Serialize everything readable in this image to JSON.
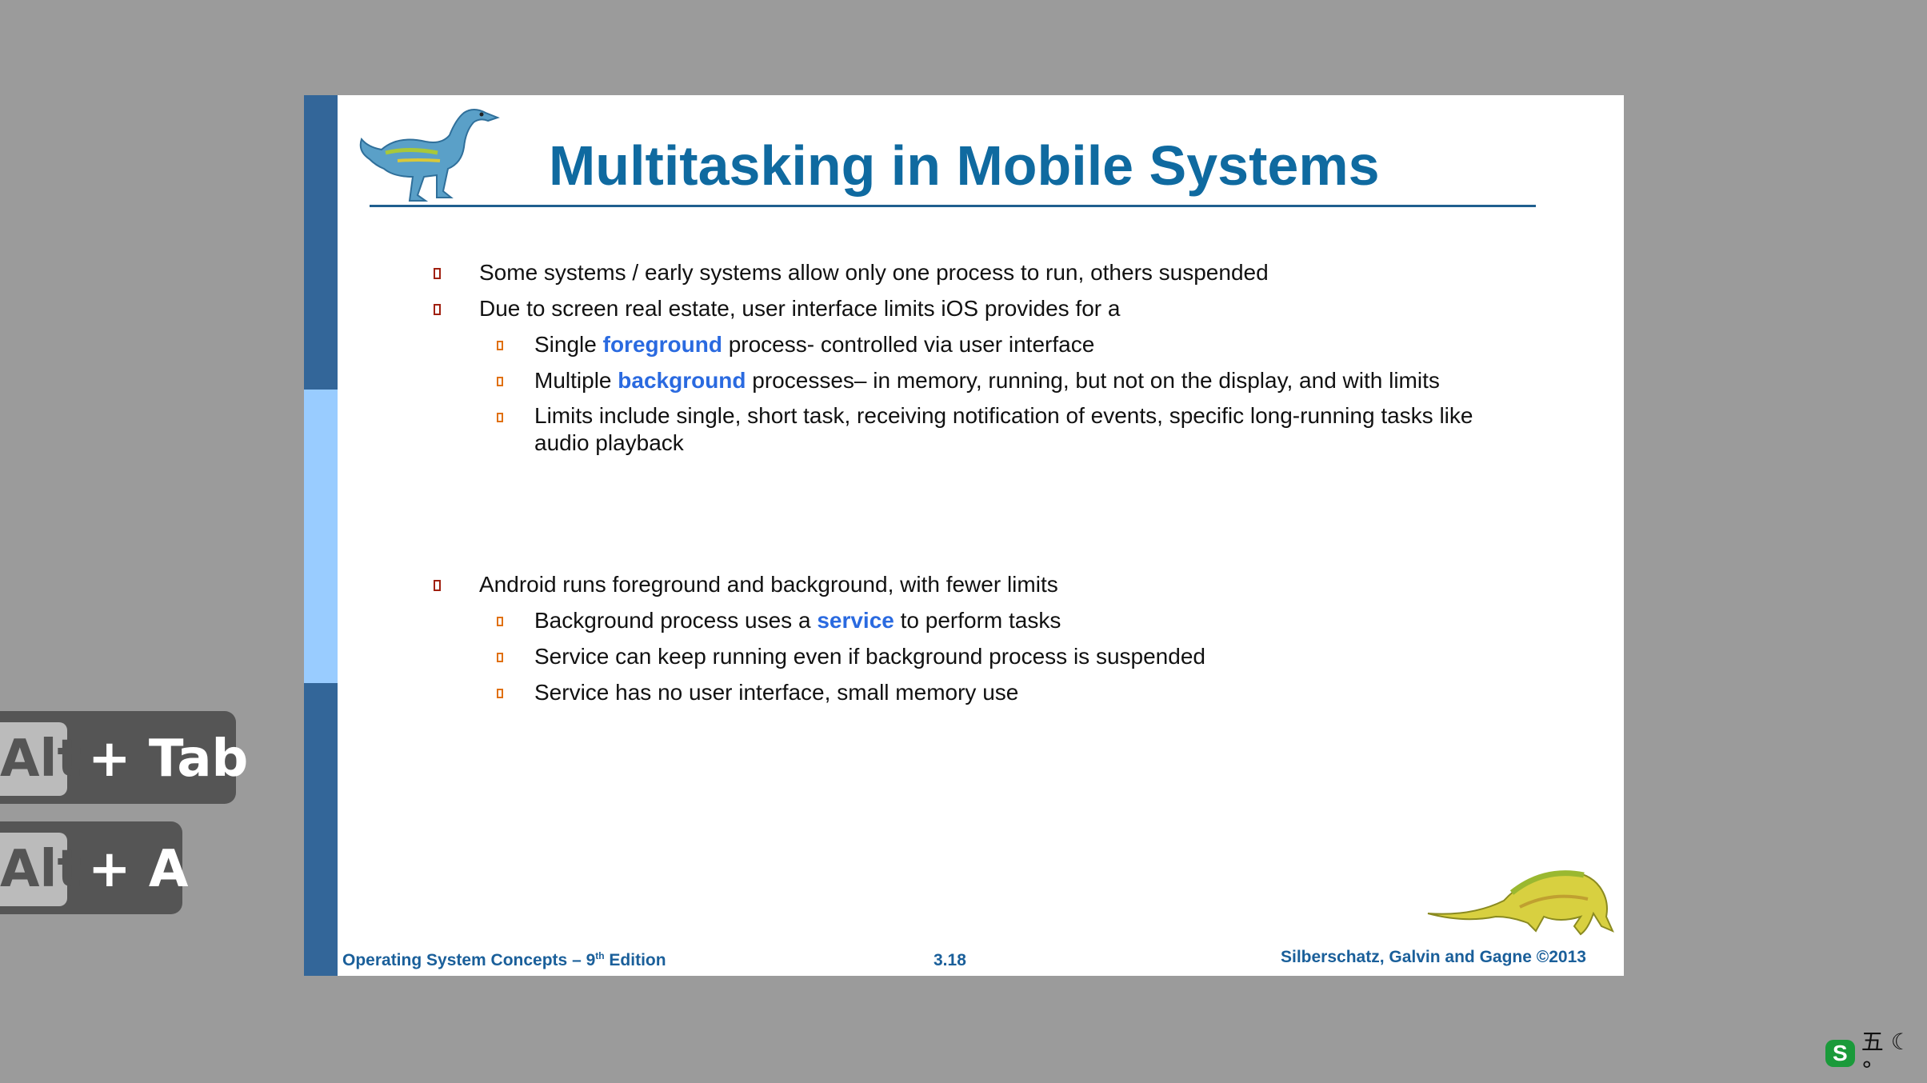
{
  "slide": {
    "title": "Multitasking in Mobile Systems",
    "bullets": [
      {
        "level": 1,
        "text": "Some systems / early systems allow only one process to run, others suspended"
      },
      {
        "level": 1,
        "text": "Due to screen real estate, user interface limits iOS provides for a"
      },
      {
        "level": 2,
        "before": "Single ",
        "highlight": "foreground",
        "after": " process- controlled via user interface"
      },
      {
        "level": 2,
        "before": "Multiple ",
        "highlight": "background",
        "after": " processes– in memory, running, but not on the display, and with limits"
      },
      {
        "level": 2,
        "line1": "Limits include single, short task, receiving notification of events, specific long-running tasks like",
        "line2": "audio playback"
      },
      {
        "level": 1,
        "text": "Android runs foreground and background, with fewer limits"
      },
      {
        "level": 2,
        "before": "Background process uses a ",
        "highlight": "service",
        "after": " to perform tasks"
      },
      {
        "level": 2,
        "text": "Service can keep running even if background process is suspended"
      },
      {
        "level": 2,
        "text": "Service has no user interface, small memory use"
      }
    ],
    "footer": {
      "left": "Operating System Concepts – 9",
      "left_sup": "th",
      "left_suffix": " Edition",
      "center": "3.18",
      "right": "Silberschatz, Galvin and Gagne ©2013"
    }
  },
  "overlay": {
    "shortcut1": {
      "key": "Alt",
      "rest": "+ Tab"
    },
    "shortcut2": {
      "key": "Alt",
      "rest": "+ A"
    }
  },
  "tray": {
    "logo": "S",
    "text": "五 ☾ °"
  },
  "colors": {
    "background": "#9b9b9b",
    "title": "#0f6aa0",
    "highlight": "#2a6ae0",
    "sidebar_dark": "#336699",
    "sidebar_light": "#99ccff"
  }
}
